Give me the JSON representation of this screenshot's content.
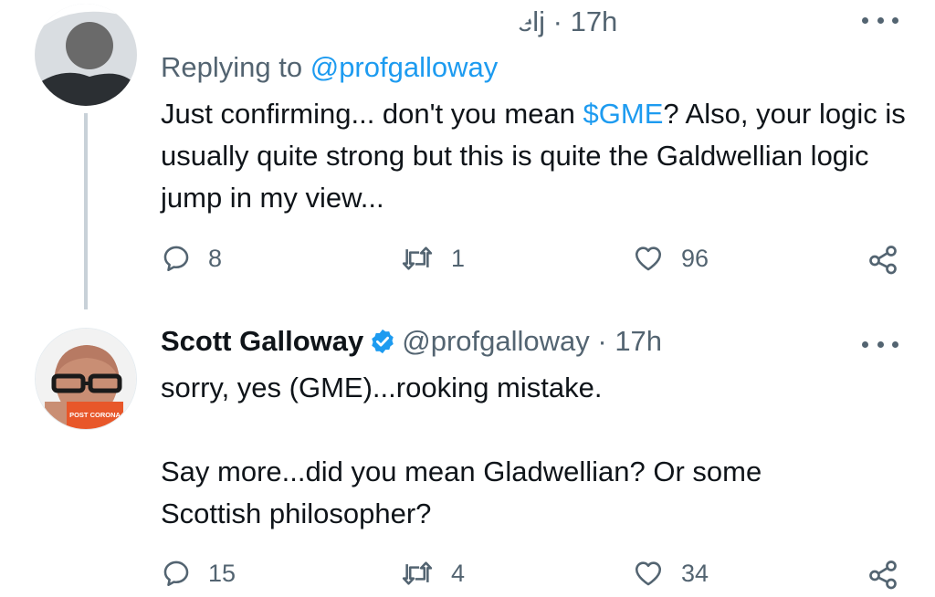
{
  "tweets": [
    {
      "handle_fragment": "elj",
      "time": "17h",
      "replying_label": "Replying to ",
      "replying_handle": "@profgalloway",
      "body_before": "Just confirming... don't you mean ",
      "cashtag": "$GME",
      "body_after": "? Also, your logic is usually quite strong but this is quite the Galdwellian logic jump in my view...",
      "replies": "8",
      "retweets": "1",
      "likes": "96"
    },
    {
      "name": "Scott Galloway",
      "handle": "@profgalloway",
      "time": "17h",
      "paragraph1": "sorry, yes (GME)...rooking mistake.",
      "paragraph2": "Say more...did you mean Gladwellian?  Or some Scottish philosopher?",
      "replies": "15",
      "retweets": "4",
      "likes": "34",
      "avatar_book_text": "POST CORONA"
    }
  ],
  "icons": [
    "more-icon",
    "reply-icon",
    "retweet-icon",
    "like-icon",
    "share-icon",
    "verified-icon"
  ],
  "colors": {
    "accent": "#1d9bf0",
    "meta": "#536471",
    "text": "#0f1419",
    "book": "#e8572a"
  }
}
